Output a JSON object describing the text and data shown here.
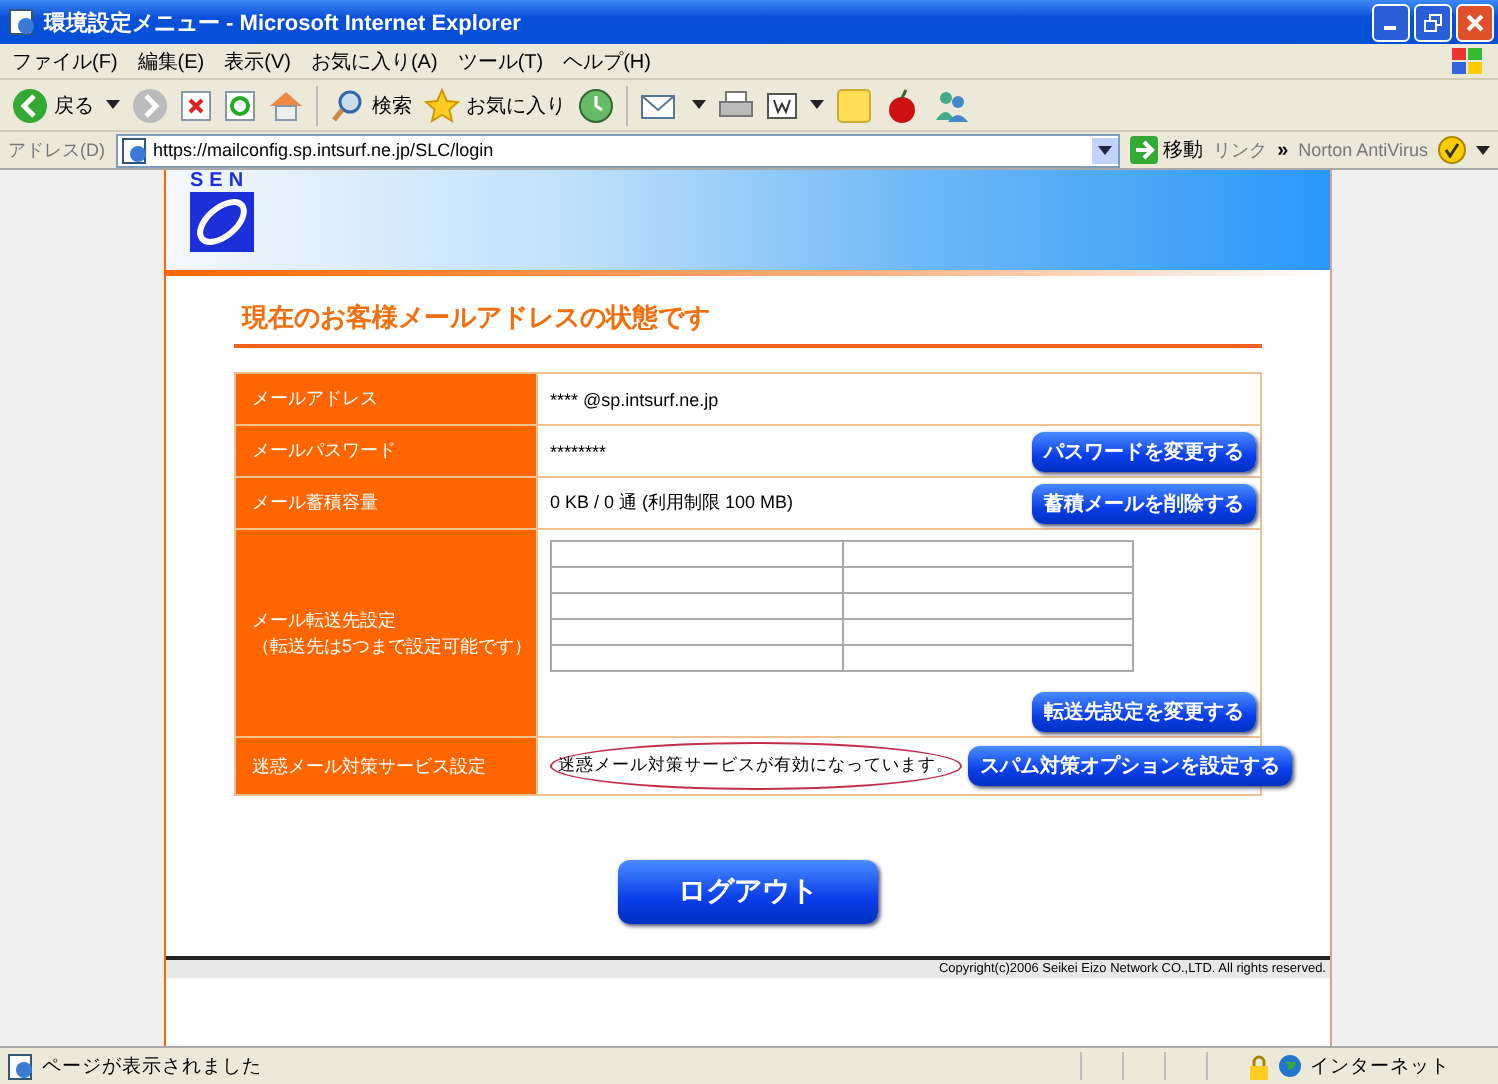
{
  "window": {
    "title": "環境設定メニュー - Microsoft Internet Explorer"
  },
  "menu": [
    "ファイル(F)",
    "編集(E)",
    "表示(V)",
    "お気に入り(A)",
    "ツール(T)",
    "ヘルプ(H)"
  ],
  "toolbar": {
    "back": "戻る",
    "search": "検索",
    "favorites": "お気に入り"
  },
  "address_bar": {
    "label": "アドレス(D)",
    "url": "https://mailconfig.sp.intsurf.ne.jp/SLC/login",
    "go": "移動",
    "links": "リンク",
    "more": "»",
    "norton": "Norton AntiVirus"
  },
  "page": {
    "logo": "SEN",
    "heading": "現在のお客様メールアドレスの状態です",
    "rows": [
      {
        "kind": "text",
        "label": "メールアドレス",
        "value": "**** @sp.intsurf.ne.jp"
      },
      {
        "kind": "text",
        "label": "メールパスワード",
        "value": "********",
        "button": "パスワードを変更する"
      },
      {
        "kind": "text",
        "label": "メール蓄積容量",
        "value": "0 KB / 0 通 (利用制限 100 MB)",
        "button": "蓄積メールを削除する"
      },
      {
        "kind": "forwarding",
        "label": "メール転送先設定",
        "note": "（転送先は5つまで設定可能です）",
        "button": "転送先設定を変更する"
      },
      {
        "kind": "text",
        "label": "迷惑メール対策サービス設定",
        "value": "迷惑メール対策サービスが有効になっています。",
        "circled": true,
        "button": "スパム対策オプションを設定する"
      }
    ],
    "logout": "ログアウト",
    "copyright": "Copyright(c)2006 Seikei Eizo Network CO.,LTD. All rights reserved."
  },
  "status_bar": {
    "text": "ページが表示されました",
    "zone": "インターネット"
  }
}
